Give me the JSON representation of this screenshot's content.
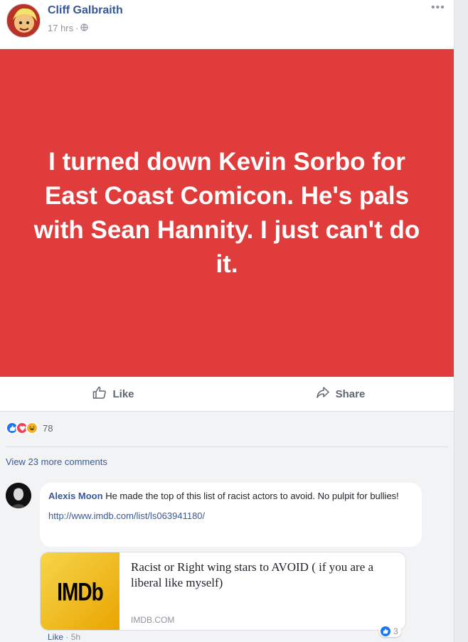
{
  "post": {
    "author": "Cliff Galbraith",
    "time": "17 hrs",
    "dot": "·",
    "more_icon": "•••",
    "status_text": "I turned down Kevin Sorbo for East Coast Comicon. He's pals with Sean Hannity. I just can't do it.",
    "status_bg_color": "#e13c3c"
  },
  "actions": {
    "like_label": "Like",
    "share_label": "Share"
  },
  "reactions": {
    "icons": [
      "like-icon",
      "love-icon",
      "haha-icon"
    ],
    "count": "78"
  },
  "comments": {
    "view_more": "View 23 more comments",
    "items": [
      {
        "author": "Alexis Moon",
        "text": "He made the top of this list of racist actors to avoid. No pulpit for bullies!",
        "link": "http://www.imdb.com/list/ls063941180/",
        "preview": {
          "logo": "IMDb",
          "title": "Racist or Right wing stars to AVOID ( if you are a liberal like myself)",
          "domain": "IMDB.COM"
        },
        "meta_like": "Like",
        "meta_dot": "·",
        "meta_time": "5h",
        "reaction_count": "3"
      }
    ]
  },
  "colors": {
    "link_blue": "#365899",
    "fb_like_blue": "#1877f2",
    "love_red": "#f33e58",
    "haha_yellow": "#f7b125"
  }
}
